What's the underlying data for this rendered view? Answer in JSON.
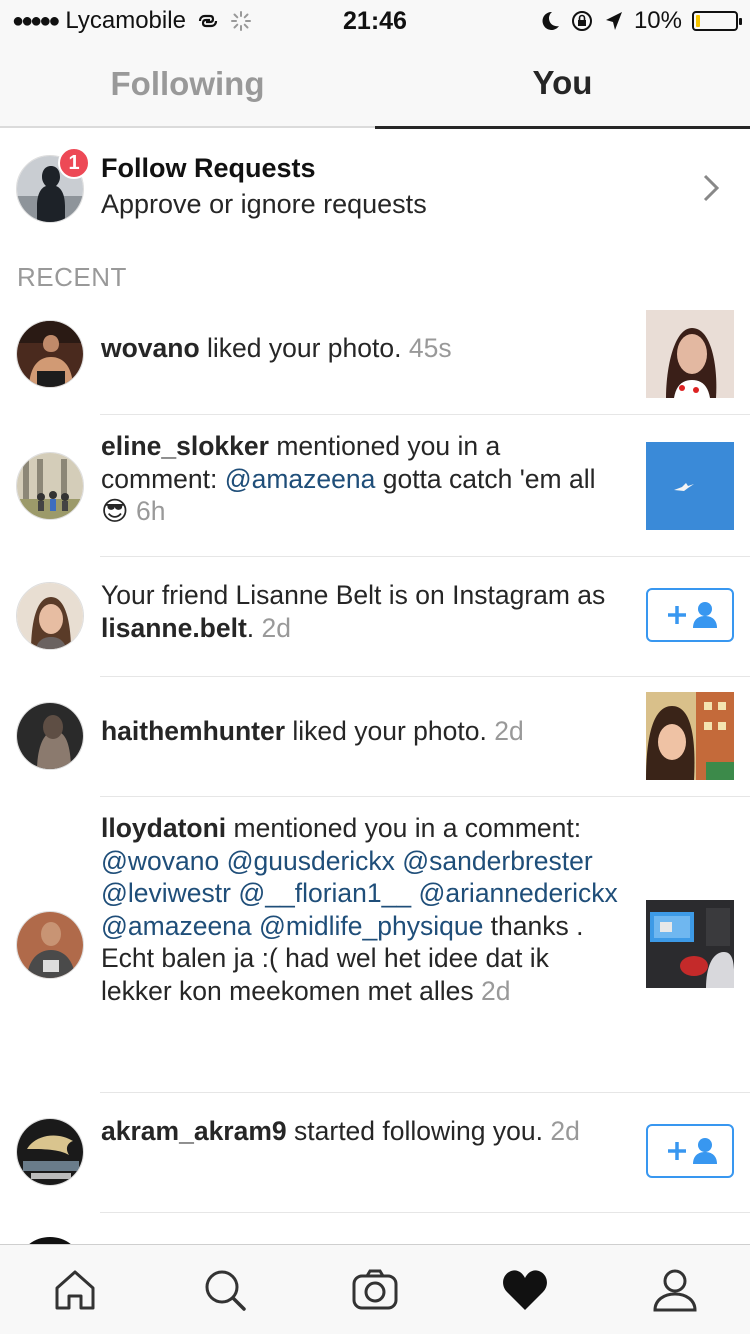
{
  "status_bar": {
    "carrier": "Lycamobile",
    "time": "21:46",
    "battery": "10%",
    "battery_level": 0.1
  },
  "tabs": {
    "following": "Following",
    "you": "You"
  },
  "follow_requests": {
    "badge_count": "1",
    "title": "Follow Requests",
    "subtitle": "Approve or ignore requests"
  },
  "recent_label": "RECENT",
  "items": [
    {
      "username": "wovano",
      "action": " liked your photo.",
      "time": "45s"
    },
    {
      "username": "eline_slokker",
      "action": " mentioned you in a comment: ",
      "mention": "@amazeena",
      "rest": " gotta catch 'em all ",
      "emoji": "😎",
      "time": "6h"
    },
    {
      "prefix": "Your friend Lisanne Belt is on Instagram as ",
      "username": "lisanne.belt",
      "suffix": ".",
      "time": "2d"
    },
    {
      "username": "haithemhunter",
      "action": " liked your photo.",
      "time": "2d"
    },
    {
      "username": "lloydatoni",
      "action": " mentioned you in a comment: ",
      "mentions": "@wovano @guusderickx @sanderbrester  @leviwestr @__florian1__  @ariannederickx @amazeena @midlife_physique",
      "rest": " thanks . Echt balen ja :( had wel het idee dat ik lekker kon meekomen met alles",
      "time": "2d"
    },
    {
      "username": "akram_akram9",
      "action": " started following you.",
      "time": "2d"
    }
  ],
  "bottom_bar": [
    "home-icon",
    "search-icon",
    "camera-icon",
    "heart-icon",
    "profile-icon"
  ]
}
